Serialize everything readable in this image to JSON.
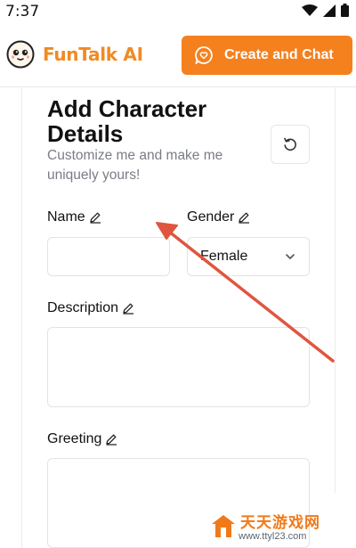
{
  "status_bar": {
    "time": "7:37"
  },
  "header": {
    "brand": "FunTalk AI",
    "cta_label": "Create and Chat"
  },
  "form": {
    "title": "Add Character Details",
    "subtitle": "Customize me and make me uniquely yours!",
    "name_label": "Name",
    "name_value": "",
    "gender_label": "Gender",
    "gender_value": "Female",
    "description_label": "Description",
    "description_value": "",
    "greeting_label": "Greeting",
    "greeting_value": ""
  },
  "watermark": {
    "line1": "天天游戏网",
    "line2": "www.ttyl23.com"
  },
  "colors": {
    "accent": "#f5801e",
    "brand_text": "#f08a24",
    "annotation_arrow": "#e0553f"
  },
  "icons": [
    "wifi-icon",
    "signal-icon",
    "battery-icon",
    "logo-face-icon",
    "chat-bubble-icon",
    "reset-icon",
    "pencil-icon",
    "chevron-down-icon"
  ]
}
